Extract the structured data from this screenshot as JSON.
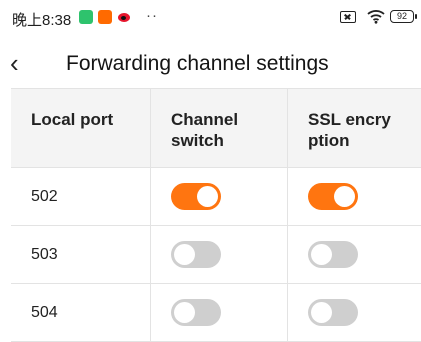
{
  "status_bar": {
    "time": "晚上8:38",
    "more": "··",
    "battery": "92"
  },
  "header": {
    "title": "Forwarding channel settings"
  },
  "table": {
    "headers": [
      "Local port",
      "Channel\nswitch",
      "SSL encry\nption"
    ],
    "rows": [
      {
        "port": "502",
        "channel_switch": true,
        "ssl_encryption": true
      },
      {
        "port": "503",
        "channel_switch": false,
        "ssl_encryption": false
      },
      {
        "port": "504",
        "channel_switch": false,
        "ssl_encryption": false
      }
    ]
  },
  "colors": {
    "toggle_on": "#ff7510",
    "toggle_off": "#cfcfcf"
  }
}
